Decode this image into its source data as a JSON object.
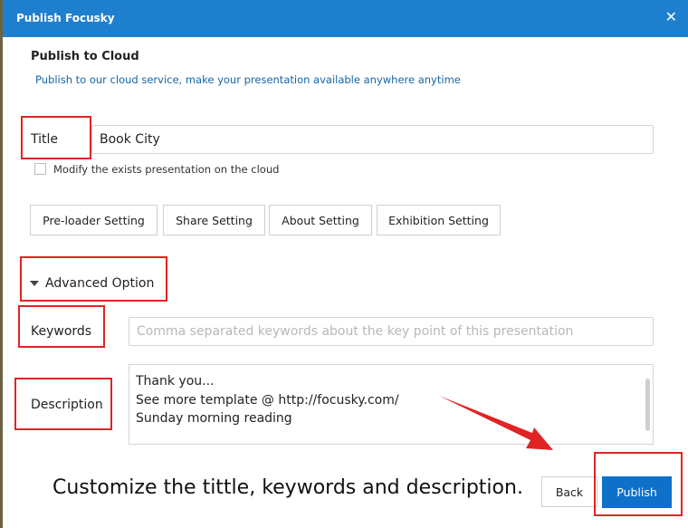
{
  "window": {
    "title": "Publish Focusky",
    "close_glyph": "✕"
  },
  "section": {
    "title": "Publish to Cloud",
    "subtitle": "Publish to our cloud service, make your presentation available anywhere anytime"
  },
  "form": {
    "title_label": "Title",
    "title_value": "Book City",
    "modify_checkbox_label": "Modify the exists presentation on the cloud",
    "modify_checked": false,
    "setting_buttons": [
      "Pre-loader Setting",
      "Share Setting",
      "About Setting",
      "Exhibition Setting"
    ],
    "advanced_label": "Advanced Option",
    "keywords_label": "Keywords",
    "keywords_placeholder": "Comma separated keywords about the key point of this presentation",
    "keywords_value": "",
    "description_label": "Description",
    "description_lines": [
      "Thank you...",
      "See more template @ http://focusky.com/",
      "Sunday morning reading"
    ]
  },
  "footer": {
    "back_label": "Back",
    "publish_label": "Publish"
  },
  "annotation": {
    "caption": "Customize the tittle, keywords and description.",
    "highlight_color": "#e02424"
  },
  "colors": {
    "titlebar": "#1f7fcf",
    "primary_button": "#0e70c9",
    "link_text": "#1565a8"
  }
}
